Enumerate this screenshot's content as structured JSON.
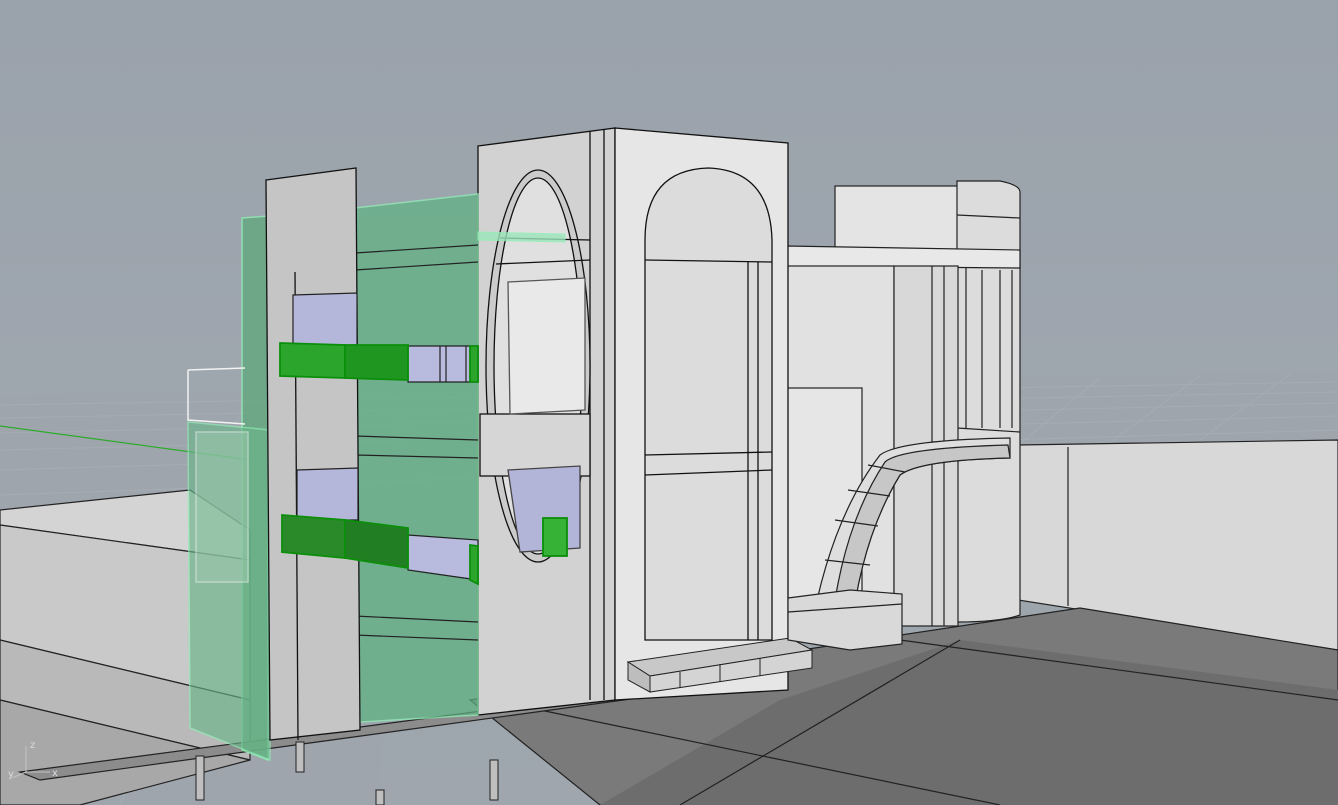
{
  "viewport": {
    "title": "",
    "background": "#9aa1aa",
    "selection_color": "#22b422"
  },
  "axes": {
    "x_label": "x",
    "y_label": "y",
    "z_label": "z"
  },
  "icons": {
    "axis": "world-axes-icon"
  }
}
